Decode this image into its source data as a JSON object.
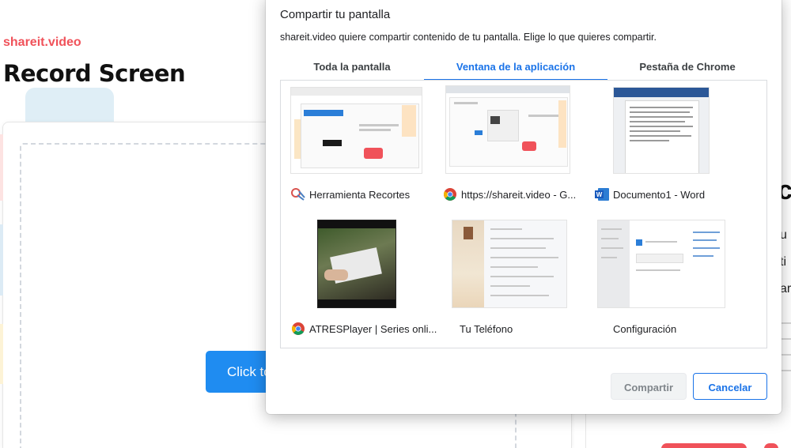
{
  "background_page": {
    "brand": "shareit.video",
    "title": "Record Screen",
    "record_button_label": "Click to",
    "right_heading": "c",
    "right_lines": [
      "u",
      "ti",
      "ar"
    ]
  },
  "dialog": {
    "title": "Compartir tu pantalla",
    "subtitle": "shareit.video quiere compartir contenido de tu pantalla. Elige lo que quieres compartir.",
    "tabs": [
      {
        "label": "Toda la pantalla",
        "active": false
      },
      {
        "label": "Ventana de la aplicación",
        "active": true
      },
      {
        "label": "Pestaña de Chrome",
        "active": false
      }
    ],
    "windows": [
      {
        "label": "Herramienta Recortes",
        "icon": "snipping-tool-icon"
      },
      {
        "label": "https://shareit.video - G...",
        "icon": "chrome-icon"
      },
      {
        "label": "Documento1 - Word",
        "icon": "word-icon"
      },
      {
        "label": "ATRESPlayer | Series onli...",
        "icon": "chrome-icon"
      },
      {
        "label": "Tu Teléfono",
        "icon": ""
      },
      {
        "label": "Configuración",
        "icon": ""
      }
    ],
    "share_button": "Compartir",
    "cancel_button": "Cancelar"
  },
  "colors": {
    "accent_blue": "#1a73e8",
    "brand_red": "#f0525a",
    "record_button_blue": "#1f8cf1"
  }
}
